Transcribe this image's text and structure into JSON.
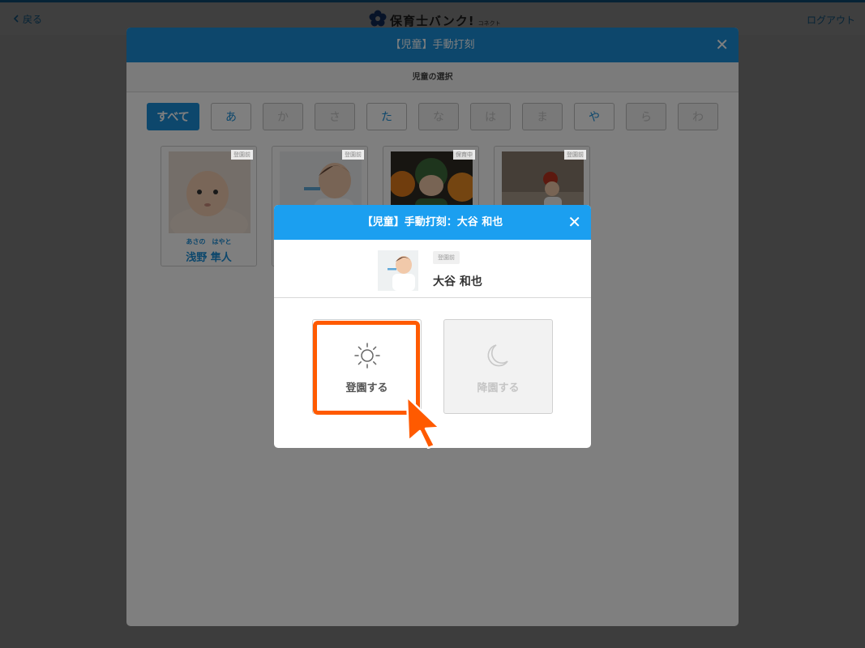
{
  "topbar": {
    "back_label": "戻る",
    "logo_text": "保育士バンク!",
    "logo_sub": "コネクト",
    "logout_label": "ログアウト"
  },
  "background_modal": {
    "title": "【児童】手動打刻",
    "subheader": "児童の選択",
    "kana_filters": [
      {
        "label": "すべて",
        "state": "active"
      },
      {
        "label": "あ",
        "state": "enabled"
      },
      {
        "label": "か",
        "state": "disabled"
      },
      {
        "label": "さ",
        "state": "disabled"
      },
      {
        "label": "た",
        "state": "enabled"
      },
      {
        "label": "な",
        "state": "disabled"
      },
      {
        "label": "は",
        "state": "disabled"
      },
      {
        "label": "ま",
        "state": "disabled"
      },
      {
        "label": "や",
        "state": "enabled"
      },
      {
        "label": "ら",
        "state": "disabled"
      },
      {
        "label": "わ",
        "state": "disabled"
      }
    ],
    "children": [
      {
        "badge": "登園前",
        "kana": "あさの　はやと",
        "name": "浅野 隼人"
      },
      {
        "badge": "登園前",
        "kana": "",
        "name": ""
      },
      {
        "badge": "保育中",
        "kana": "",
        "name": ""
      },
      {
        "badge": "登園前",
        "kana": "",
        "name": ""
      }
    ]
  },
  "punch_modal": {
    "title": "【児童】手動打刻：大谷 和也",
    "child_badge": "登園前",
    "child_name": "大谷 和也",
    "checkin_label": "登園する",
    "checkout_label": "降園する"
  },
  "colors": {
    "brand_blue": "#1b8fd8",
    "header_blue": "#1b9ff0",
    "highlight_orange": "#ff5a00"
  }
}
